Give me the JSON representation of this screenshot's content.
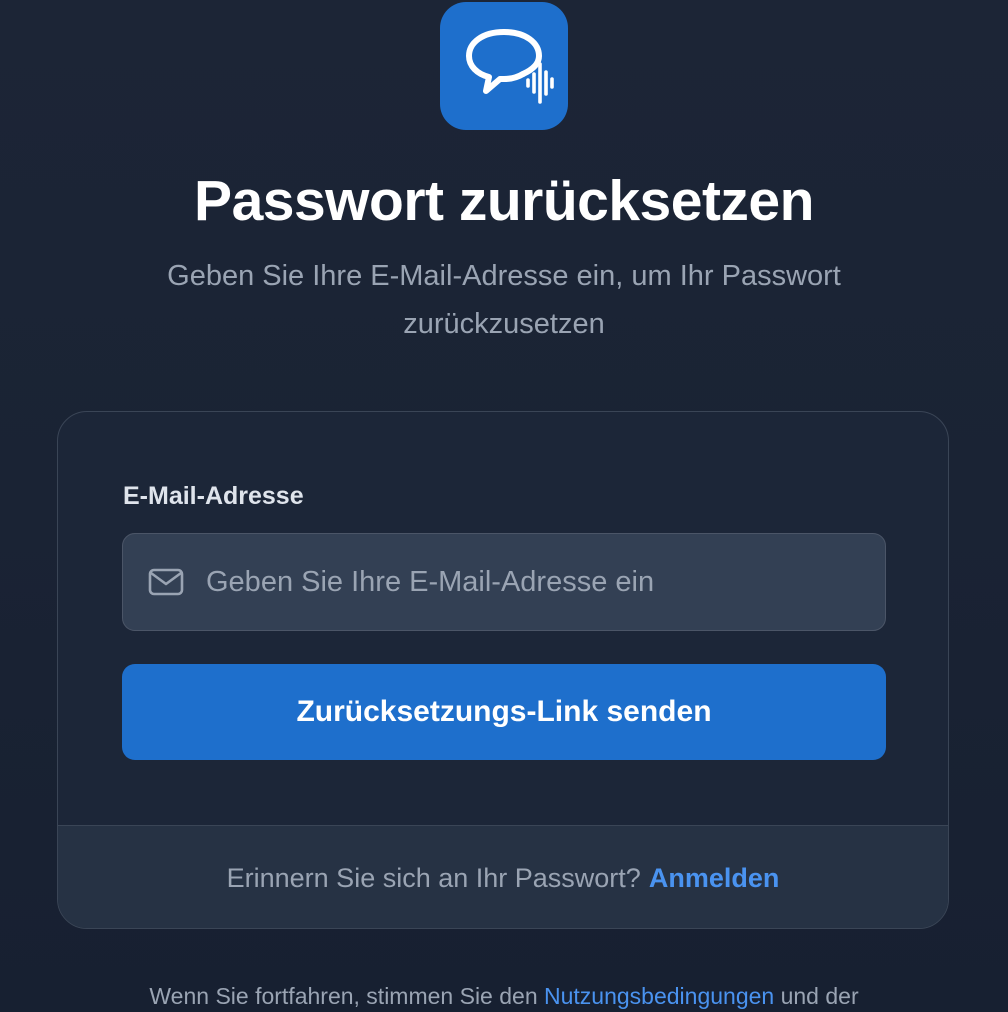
{
  "logo": {
    "icon": "chat-bubble-soundwave-icon",
    "color": "#1e6fcc"
  },
  "header": {
    "title": "Passwort zurücksetzen",
    "subtitle": "Geben Sie Ihre E-Mail-Adresse ein, um Ihr Passwort zurückzusetzen"
  },
  "form": {
    "email_label": "E-Mail-Adresse",
    "email_icon": "mail-icon",
    "email_placeholder": "Geben Sie Ihre E-Mail-Adresse ein",
    "email_value": "",
    "submit_label": "Zurücksetzungs-Link senden"
  },
  "footer": {
    "prompt": "Erinnern Sie sich an Ihr Passwort?",
    "login_link": "Anmelden"
  },
  "legal": {
    "text_before": "Wenn Sie fortfahren, stimmen Sie den",
    "terms_link": "Nutzungsbedingungen",
    "text_after": "und der"
  },
  "colors": {
    "accent": "#1e6fcc",
    "link": "#4a93f0",
    "background": "#1c2536"
  }
}
